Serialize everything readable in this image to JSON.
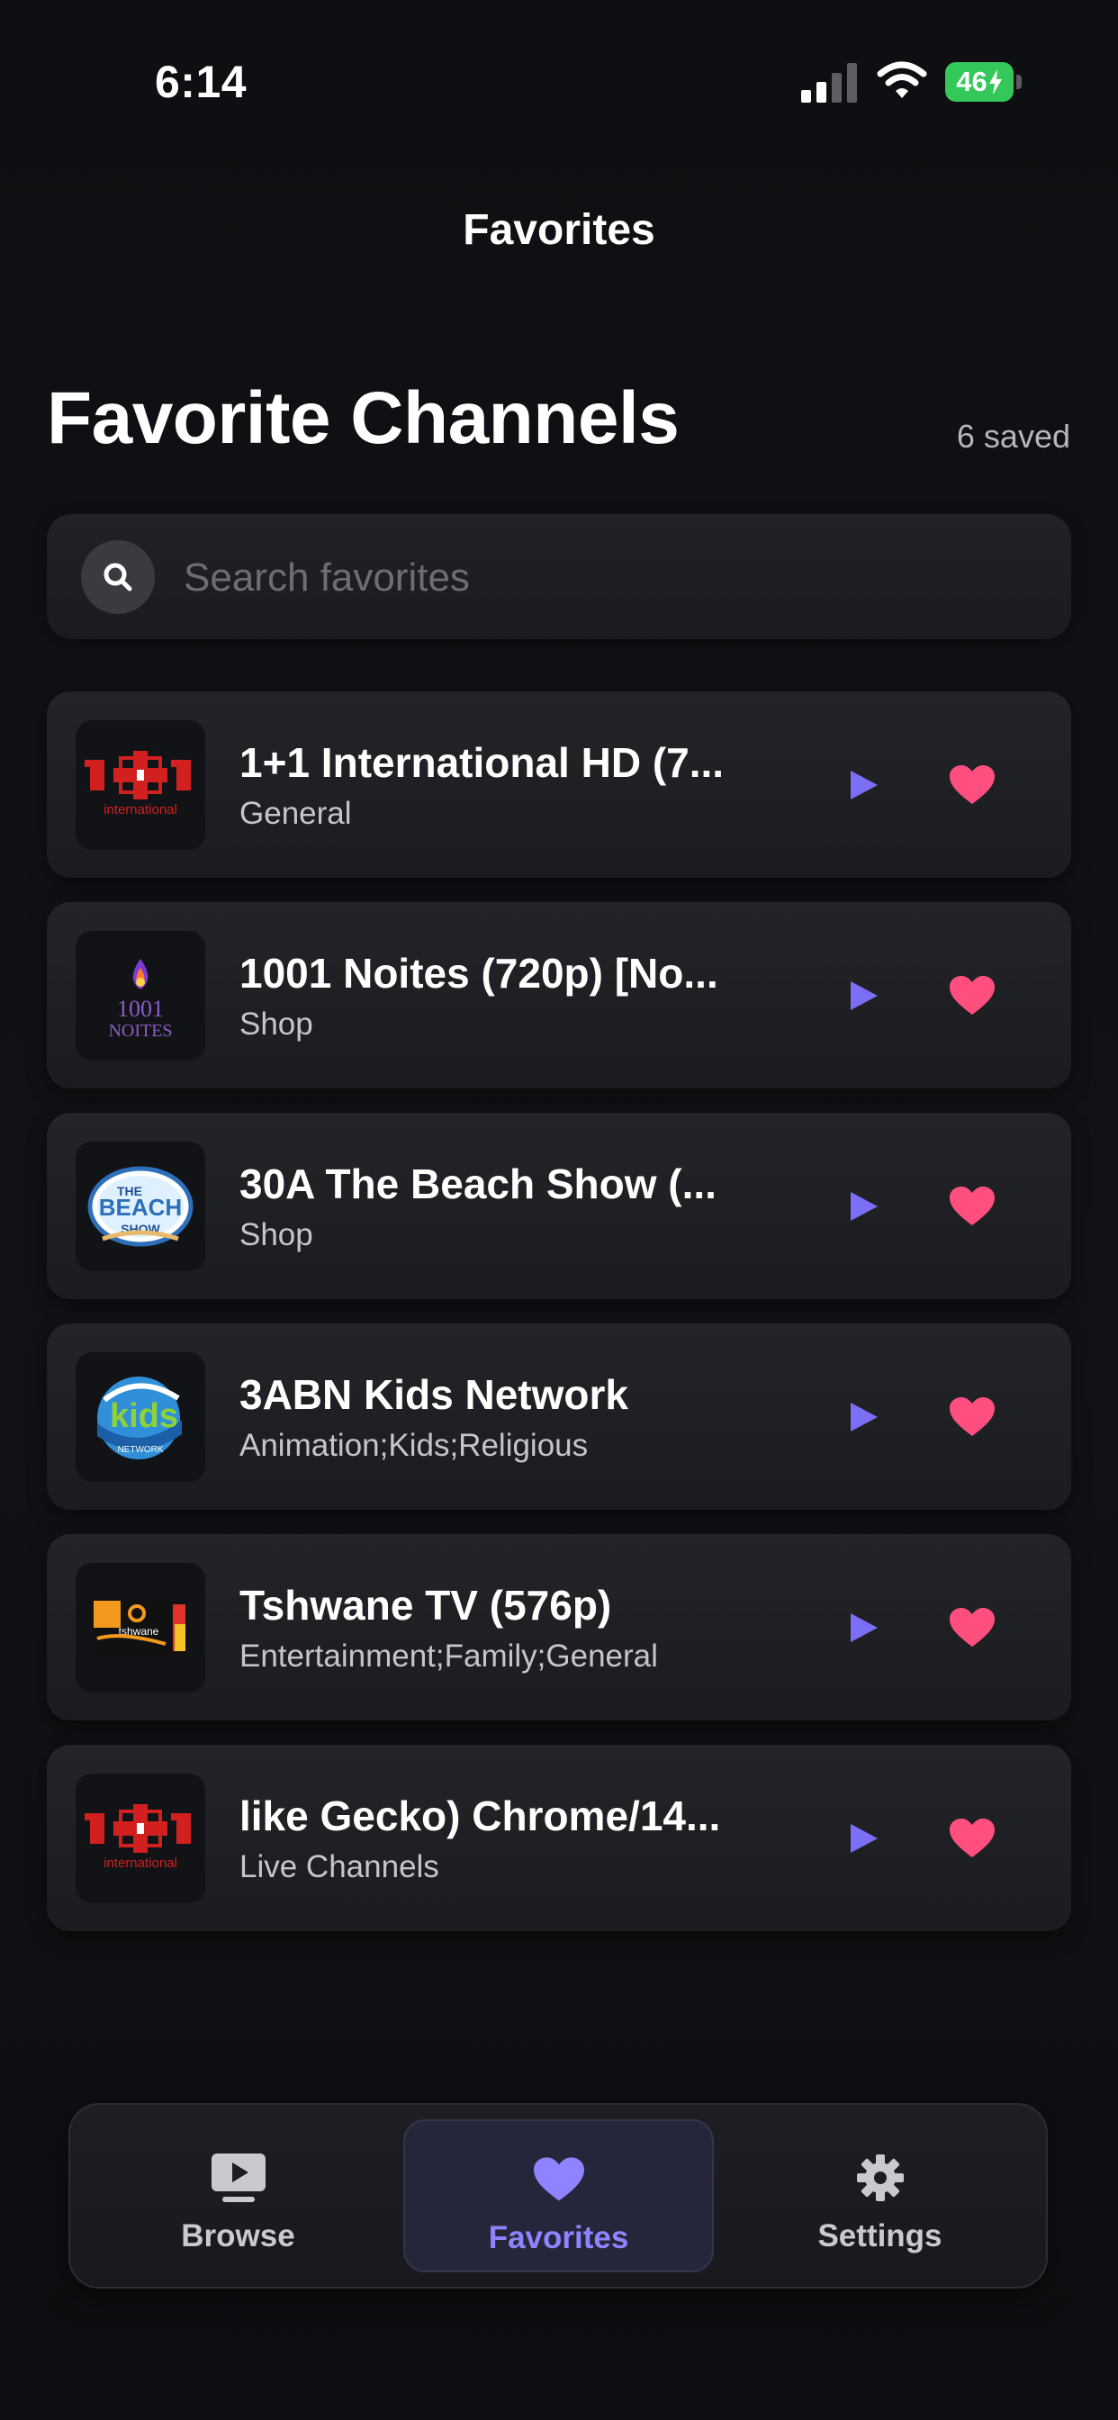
{
  "status_bar": {
    "time": "6:14",
    "battery": "46"
  },
  "nav": {
    "title": "Favorites"
  },
  "header": {
    "title": "Favorite Channels",
    "saved_count": "6 saved"
  },
  "search": {
    "placeholder": "Search favorites",
    "value": ""
  },
  "channels": [
    {
      "name": "1+1 International HD (7...",
      "category": "General",
      "logo": "1+1 international logo"
    },
    {
      "name": "1001 Noites (720p) [No...",
      "category": "Shop",
      "logo": "1001 noites logo"
    },
    {
      "name": "30A The Beach Show (...",
      "category": "Shop",
      "logo": "the beach show logo"
    },
    {
      "name": "3ABN Kids Network",
      "category": "Animation;Kids;Religious",
      "logo": "3abn kids logo"
    },
    {
      "name": "Tshwane TV (576p)",
      "category": "Entertainment;Family;General",
      "logo": "tshwane tv logo"
    },
    {
      "name": "like Gecko) Chrome/14...",
      "category": "Live Channels",
      "logo": "1+1 international logo"
    }
  ],
  "tabs": [
    {
      "label": "Browse",
      "icon": "tv-play-icon",
      "active": false
    },
    {
      "label": "Favorites",
      "icon": "heart-icon",
      "active": true
    },
    {
      "label": "Settings",
      "icon": "gear-icon",
      "active": false
    }
  ],
  "colors": {
    "accent": "#8f84ff",
    "heart": "#ff4f7e",
    "play": "#7b6ff5",
    "battery": "#34c759"
  }
}
